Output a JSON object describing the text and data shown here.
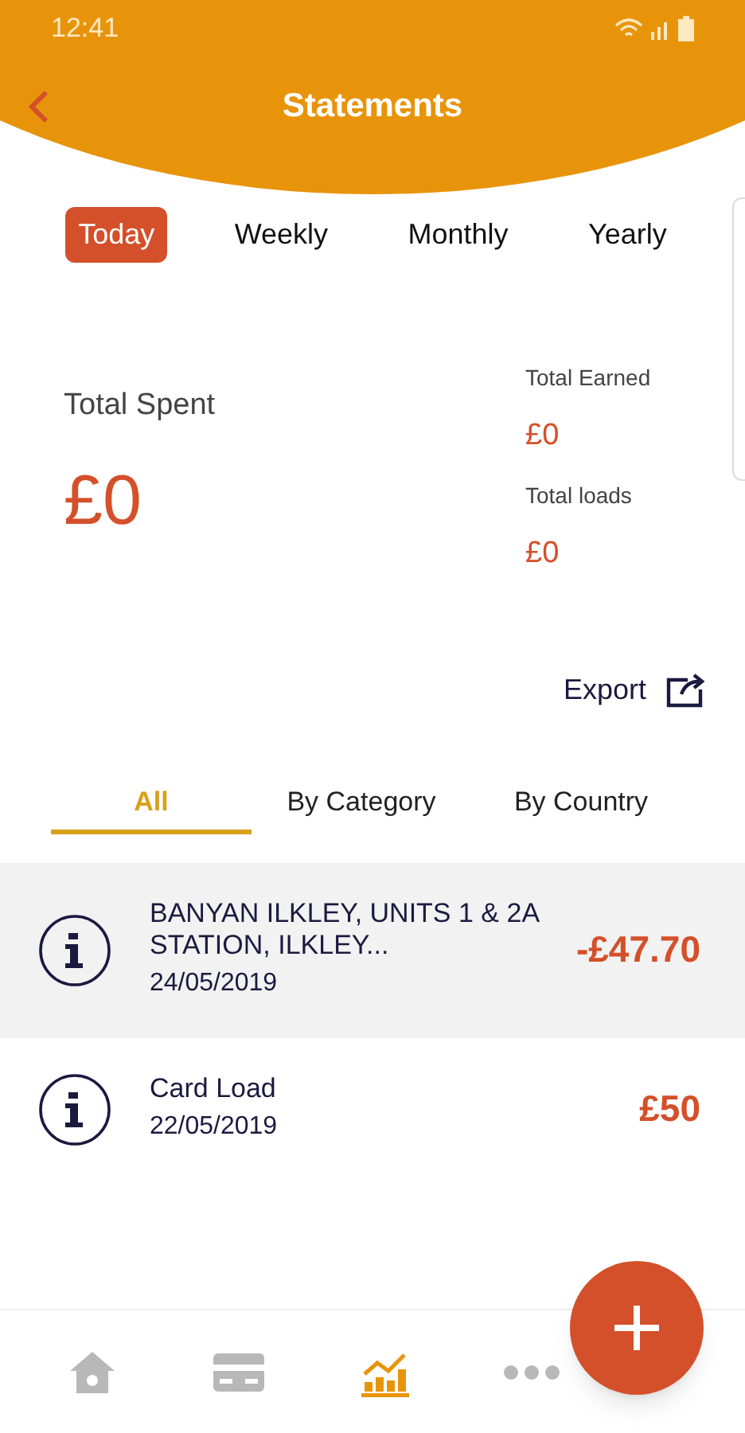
{
  "status_bar": {
    "time": "12:41"
  },
  "header": {
    "title": "Statements"
  },
  "periods": [
    {
      "label": "Today",
      "selected": true
    },
    {
      "label": "Weekly",
      "selected": false
    },
    {
      "label": "Monthly",
      "selected": false
    },
    {
      "label": "Yearly",
      "selected": false
    }
  ],
  "totals": {
    "spent_label": "Total Spent",
    "spent": "£0",
    "earned_label": "Total Earned",
    "earned": "£0",
    "loads_label": "Total loads",
    "loads": "£0"
  },
  "export": {
    "label": "Export"
  },
  "filters": [
    {
      "label": "All",
      "selected": true
    },
    {
      "label": "By Category",
      "selected": false
    },
    {
      "label": "By Country",
      "selected": false
    }
  ],
  "transactions": [
    {
      "title": "BANYAN ILKLEY, UNITS 1 & 2A STATION, ILKLEY...",
      "date": "24/05/2019",
      "amount": "-£47.70",
      "selected": true
    },
    {
      "title": "Card Load",
      "date": "22/05/2019",
      "amount": "£50",
      "selected": false
    }
  ],
  "nav": [
    {
      "kind": "home",
      "selected": false
    },
    {
      "kind": "card",
      "selected": false
    },
    {
      "kind": "chart",
      "selected": true
    },
    {
      "kind": "more",
      "selected": false
    }
  ]
}
